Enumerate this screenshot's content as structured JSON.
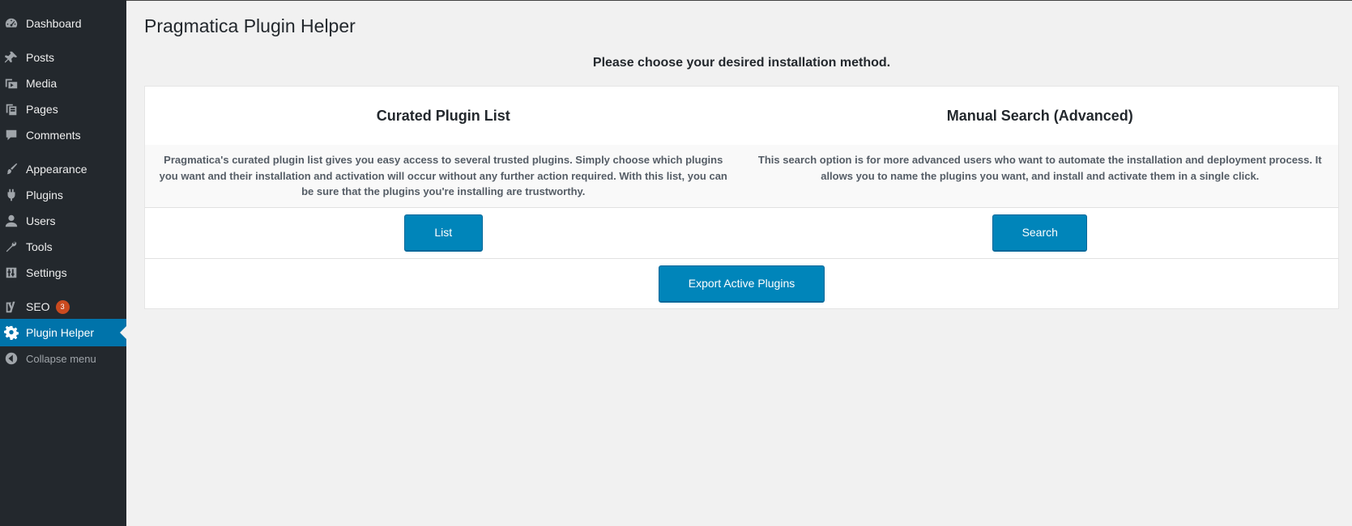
{
  "sidebar": {
    "items": [
      {
        "key": "dashboard",
        "label": "Dashboard",
        "icon": "dashboard-icon"
      },
      {
        "key": "posts",
        "label": "Posts",
        "icon": "pushpin-icon"
      },
      {
        "key": "media",
        "label": "Media",
        "icon": "media-icon"
      },
      {
        "key": "pages",
        "label": "Pages",
        "icon": "pages-icon"
      },
      {
        "key": "comments",
        "label": "Comments",
        "icon": "comment-bubble-icon"
      },
      {
        "key": "appearance",
        "label": "Appearance",
        "icon": "paintbrush-icon"
      },
      {
        "key": "plugins",
        "label": "Plugins",
        "icon": "plug-icon"
      },
      {
        "key": "users",
        "label": "Users",
        "icon": "user-icon"
      },
      {
        "key": "tools",
        "label": "Tools",
        "icon": "wrench-icon"
      },
      {
        "key": "settings",
        "label": "Settings",
        "icon": "sliders-icon"
      },
      {
        "key": "seo",
        "label": "SEO",
        "icon": "yoast-icon",
        "badge": "3"
      },
      {
        "key": "plugin-helper",
        "label": "Plugin Helper",
        "icon": "gear-icon",
        "current": true
      }
    ],
    "collapse_label": "Collapse menu",
    "collapse_icon": "collapse-arrow-icon"
  },
  "main": {
    "title": "Pragmatica Plugin Helper",
    "subheading": "Please choose your desired installation method.",
    "columns": [
      {
        "title": "Curated Plugin List",
        "description": "Pragmatica's curated plugin list gives you easy access to several trusted plugins. Simply choose which plugins you want and their installation and activation will occur without any further action required. With this list, you can be sure that the plugins you're installing are trustworthy.",
        "button": "List"
      },
      {
        "title": "Manual Search (Advanced)",
        "description": "This search option is for more advanced users who want to automate the installation and deployment process. It allows you to name the plugins you want, and install and activate them in a single click.",
        "button": "Search"
      }
    ],
    "export_button": "Export Active Plugins"
  },
  "colors": {
    "sidebar_bg": "#23282d",
    "current_item_bg": "#0073aa",
    "button_bg": "#0085ba",
    "badge_bg": "#ca4a1f",
    "page_bg": "#f1f1f1"
  }
}
